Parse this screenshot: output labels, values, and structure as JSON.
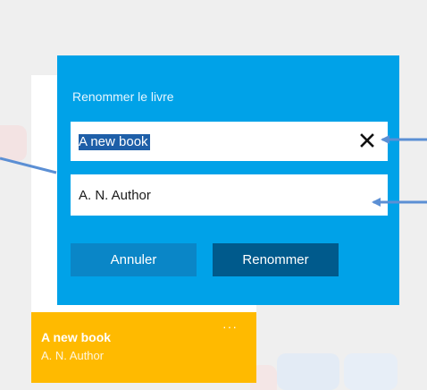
{
  "dialog": {
    "title": "Renommer le livre",
    "title_field_value": "A new book",
    "author_field_value": "A. N. Author",
    "cancel_label": "Annuler",
    "rename_label": "Renommer"
  },
  "tile": {
    "title": "A new book",
    "author": "A. N. Author",
    "more": "···"
  },
  "colors": {
    "dialog_bg": "#00a2e8",
    "tile_bg": "#ffba00",
    "rename_button": "#005a8c",
    "cancel_button": "#0a86c7",
    "arrow": "#5b8fd4"
  },
  "icons": {
    "clear": "close-icon",
    "more": "more-icon"
  }
}
